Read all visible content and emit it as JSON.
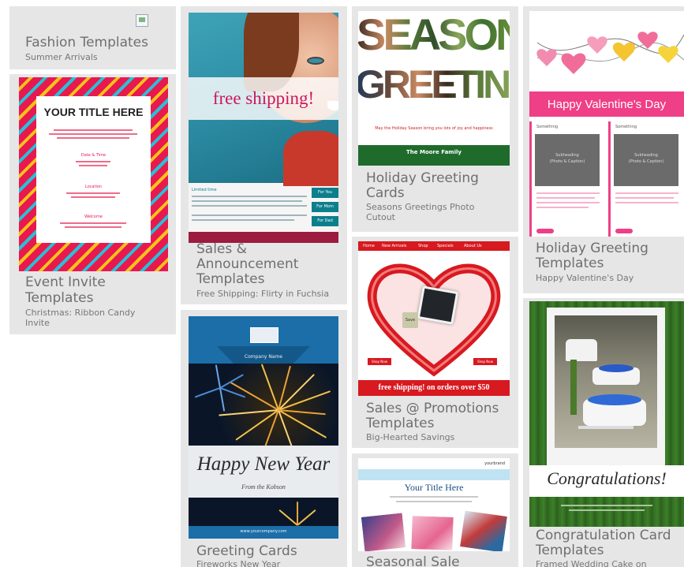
{
  "cards": [
    {
      "title": "Fashion Templates",
      "subtitle": "Summer Arrivals"
    },
    {
      "title_lines": [
        "Event Invite",
        "Templates"
      ],
      "subtitle_lines": [
        "Christmas: Ribbon Candy",
        "Invite"
      ]
    },
    {
      "title_lines": [
        "Sales &",
        "Announcement",
        "Templates"
      ],
      "subtitle": "Free Shipping: Flirty in Fuchsia"
    },
    {
      "title": "Greeting Cards",
      "subtitle": "Fireworks New Year"
    },
    {
      "title_lines": [
        "Holiday Greeting",
        "Cards"
      ],
      "subtitle_lines": [
        "Seasons Greetings Photo",
        "Cutout"
      ]
    },
    {
      "title_lines": [
        "Sales @ Promotions",
        "Templates"
      ],
      "subtitle": "Big-Hearted Savings"
    },
    {
      "title": "Seasonal Sale"
    },
    {
      "title_lines": [
        "Holiday Greeting",
        "Templates"
      ],
      "subtitle": "Happy Valentine's Day"
    },
    {
      "title_lines": [
        "Congratulation Card",
        "Templates"
      ],
      "subtitle": "Framed Wedding Cake on"
    }
  ],
  "thumbs": {
    "event": {
      "heading": "YOUR TITLE HERE",
      "section_a": "Date & Time",
      "section_b": "Location",
      "section_c": "Welcome"
    },
    "shipping": {
      "banner": "free shipping!",
      "section": "Limited time",
      "buttons": [
        "For You",
        "For Mom",
        "For Dad"
      ]
    },
    "season": {
      "line1": "SEASON",
      "line2": "GREETING",
      "tagline": "May the Holiday Season bring you lots of joy and happiness",
      "family": "The Moore Family"
    },
    "valentine": {
      "banner": "Happy Valentine's Day",
      "col_heading": "Something",
      "photo_caption": "Subheading",
      "photo_sub": "(Photo & Caption)"
    },
    "heart": {
      "nav": [
        "Home",
        "New Arrivals",
        "Shop",
        "Specials",
        "About Us"
      ],
      "badge": "Save",
      "button_left": "Shop Now",
      "button_right": "Shop Now",
      "footer": "free shipping! on orders over $50"
    },
    "newyear": {
      "company": "Company Name",
      "greeting": "Happy New Year",
      "from": "From the Kobson",
      "url": "www.yourcompany.com"
    },
    "seasonal": {
      "brand": "yourbrand",
      "title": "Your Title Here"
    },
    "congrats": {
      "greeting": "Congratulations!"
    }
  },
  "colors": {
    "card_bg": "#e6e6e6",
    "text": "#6f6f6f",
    "pink": "#ef3f86",
    "red": "#d71920",
    "green": "#1f6b2c",
    "navy": "#0b3b6b"
  }
}
